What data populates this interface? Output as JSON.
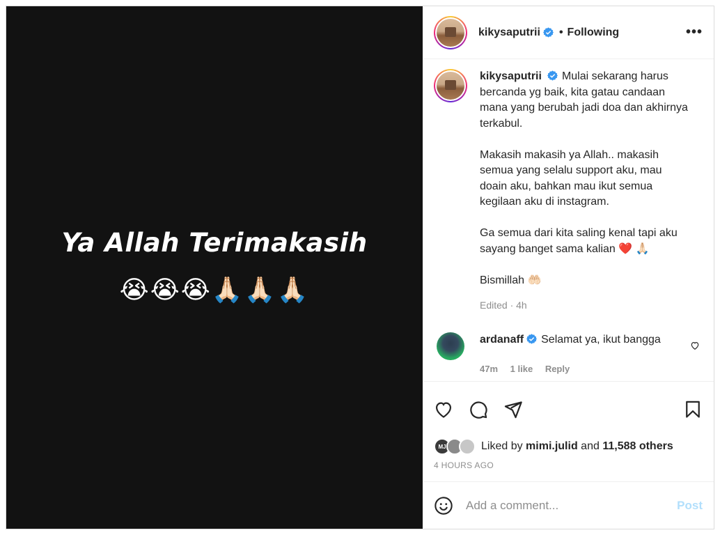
{
  "media": {
    "headline": "Ya Allah Terimakasih",
    "emoji": "😭😭😭🙏🏻🙏🏻🙏🏻"
  },
  "header": {
    "username": "kikysaputrii",
    "separator": "•",
    "follow_status": "Following",
    "more_label": "•••"
  },
  "caption": {
    "username": "kikysaputrii",
    "paragraph_1": "Mulai sekarang harus bercanda yg baik, kita gatau candaan mana yang berubah jadi doa dan akhirnya terkabul.",
    "paragraph_2": "Makasih makasih ya Allah.. makasih semua yang selalu support aku, mau doain aku, bahkan mau ikut semua kegilaan aku di instagram.",
    "paragraph_3_text": "Ga semua dari kita saling kenal tapi aku sayang banget sama kalian",
    "paragraph_3_emoji": "❤️ 🙏🏻",
    "paragraph_4": "Bismillah 🤲🏻",
    "meta": "Edited · 4h"
  },
  "comments": [
    {
      "username": "ardanaff",
      "text": "Selamat ya, ikut bangga",
      "time": "47m",
      "likes": "1 like",
      "reply": "Reply"
    }
  ],
  "likes": {
    "prefix": "Liked by",
    "user": "mimi.julid",
    "conjunction": "and",
    "count": "11,588 others",
    "first_avatar_text": "MJ"
  },
  "timestamp": "4 HOURS AGO",
  "add_comment": {
    "placeholder": "Add a comment...",
    "post_label": "Post"
  },
  "colors": {
    "verified": "#3897f0",
    "post_disabled": "#b2dffc",
    "muted": "#8e8e8e"
  },
  "icons": [
    "heart-icon",
    "comment-icon",
    "share-icon",
    "bookmark-icon",
    "emoji-icon",
    "verified-icon",
    "more-icon"
  ]
}
